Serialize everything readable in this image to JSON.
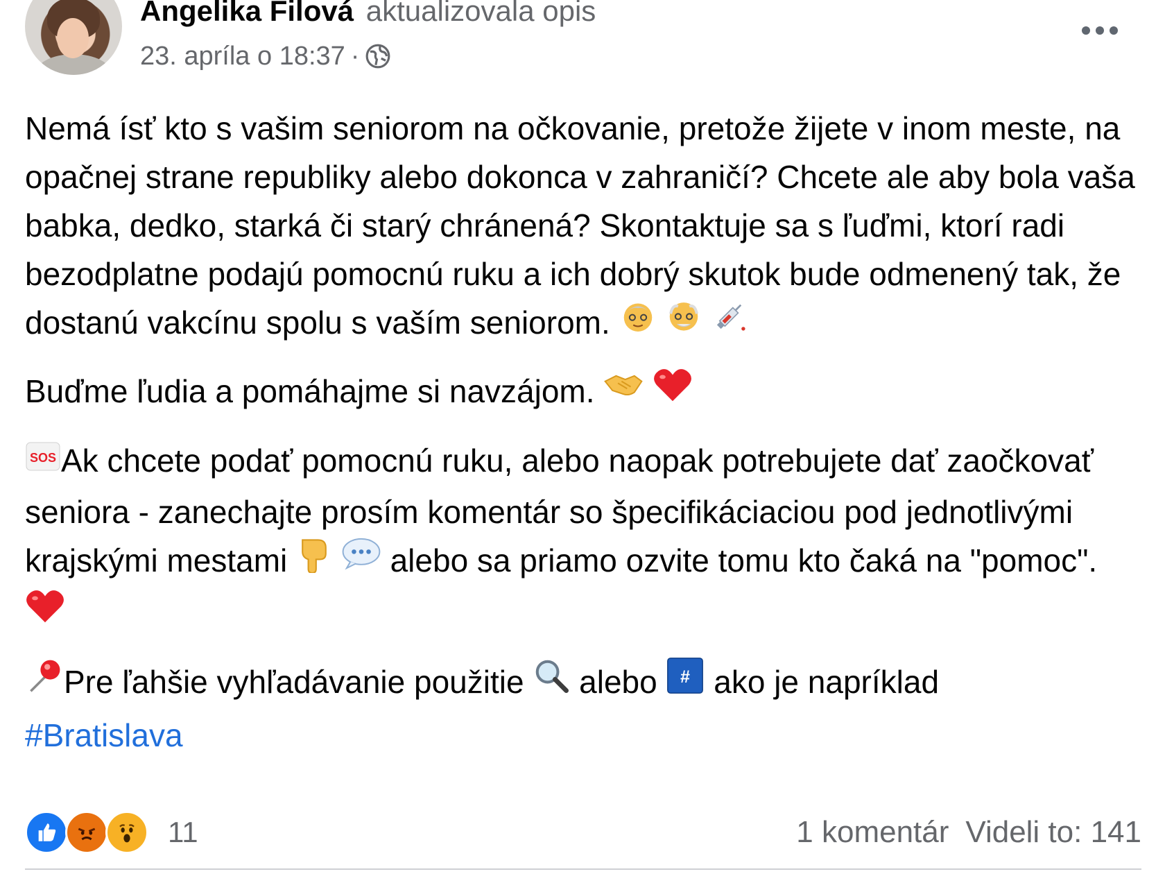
{
  "post": {
    "author": "Angelika Filová",
    "action": "aktualizovala opis",
    "timestamp": "23. apríla o 18:37",
    "separator": "·",
    "privacy_icon": "globe-icon",
    "paragraph1": "Nemá ísť kto s vašim seniorom na očkovanie, pretože žijete v inom meste, na opačnej strane republiky alebo dokonca v zahraničí? Chcete ale aby bola vaša babka, dedko, starká či starý chránená? Skontaktuje sa s ľuďmi, ktorí radi bezodplatne podajú pomocnú ruku a ich dobrý skutok bude odmenený tak, že dostanú vakcínu spolu s vaším seniorom.",
    "paragraph2": "Buďme ľudia a pomáhajme si navzájom.",
    "paragraph3_a": "Ak chcete podať pomocnú ruku, alebo naopak potrebujete dať zaočkovať seniora - zanechajte prosím komentár so špecifikáciaciou pod jednotlivými krajskými mestami",
    "paragraph3_b": "alebo sa priamo ozvite tomu kto čaká na \"pomoc\".",
    "paragraph4_a": "Pre ľahšie vyhľadávanie použitie",
    "paragraph4_b": "alebo",
    "paragraph4_c": "ako je napríklad",
    "hashtag": "#Bratislava",
    "hash_label": "#",
    "sos_label": "SOS"
  },
  "footer": {
    "reaction_count": "11",
    "comments": "1 komentár",
    "views": "Videli to: 141"
  },
  "colors": {
    "like": "#1877f2",
    "angry": "#e9710f",
    "wow": "#f7b125",
    "hashtag": "#216fdb",
    "secondary_text": "#65676b"
  }
}
